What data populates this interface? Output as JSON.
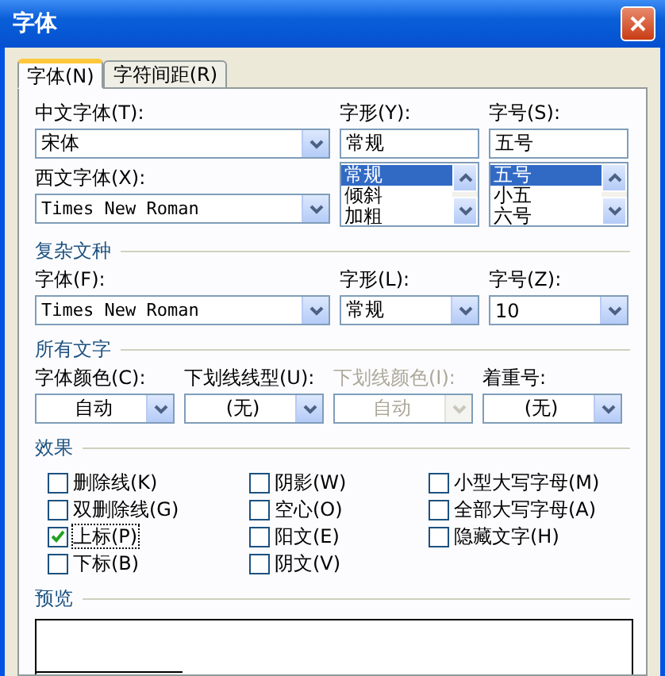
{
  "window": {
    "title": "字体"
  },
  "tabs": [
    {
      "label": "字体(N)",
      "selected": true
    },
    {
      "label": "字符间距(R)",
      "selected": false
    }
  ],
  "chinese_font": {
    "label": "中文字体(T):",
    "value": "宋体"
  },
  "western_font": {
    "label": "西文字体(X):",
    "value": "Times New Roman"
  },
  "style": {
    "label": "字形(Y):",
    "value": "常规",
    "options": [
      {
        "label": "常规",
        "selected": true
      },
      {
        "label": "倾斜",
        "selected": false
      },
      {
        "label": "加粗",
        "selected": false
      }
    ]
  },
  "size": {
    "label": "字号(S):",
    "value": "五号",
    "options": [
      {
        "label": "五号",
        "selected": true
      },
      {
        "label": "小五",
        "selected": false
      },
      {
        "label": "六号",
        "selected": false
      }
    ]
  },
  "complex_script": {
    "heading": "复杂文种",
    "font": {
      "label": "字体(F):",
      "value": "Times New Roman"
    },
    "style": {
      "label": "字形(L):",
      "value": "常规"
    },
    "size": {
      "label": "字号(Z):",
      "value": "10"
    }
  },
  "all_text": {
    "heading": "所有文字",
    "fields": [
      {
        "label": "字体颜色(C):",
        "value": "自动",
        "disabled": false
      },
      {
        "label": "下划线线型(U):",
        "value": "(无)",
        "disabled": false
      },
      {
        "label": "下划线颜色(I):",
        "value": "自动",
        "disabled": true
      },
      {
        "label": "着重号:",
        "value": "(无)",
        "disabled": false
      }
    ]
  },
  "effects": {
    "heading": "效果",
    "columns": [
      [
        {
          "label": "删除线(K)",
          "checked": false,
          "focused": false
        },
        {
          "label": "双删除线(G)",
          "checked": false,
          "focused": false
        },
        {
          "label": "上标(P)",
          "checked": true,
          "focused": true
        },
        {
          "label": "下标(B)",
          "checked": false,
          "focused": false
        }
      ],
      [
        {
          "label": "阴影(W)",
          "checked": false,
          "focused": false
        },
        {
          "label": "空心(O)",
          "checked": false,
          "focused": false
        },
        {
          "label": "阳文(E)",
          "checked": false,
          "focused": false
        },
        {
          "label": "阴文(V)",
          "checked": false,
          "focused": false
        }
      ],
      [
        {
          "label": "小型大写字母(M)",
          "checked": false,
          "focused": false
        },
        {
          "label": "全部大写字母(A)",
          "checked": false,
          "focused": false
        },
        {
          "label": "隐藏文字(H)",
          "checked": false,
          "focused": false
        }
      ]
    ]
  },
  "preview": {
    "heading": "预览"
  }
}
